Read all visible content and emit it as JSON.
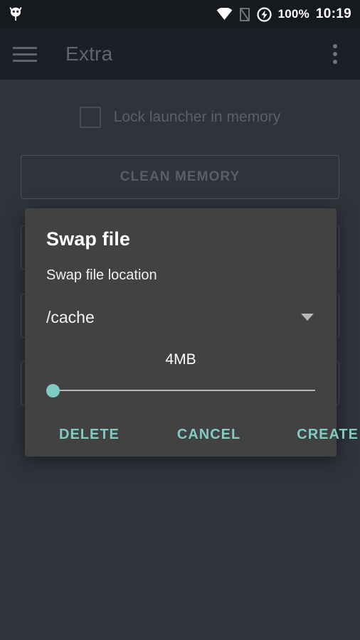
{
  "status_bar": {
    "notification_icon": "app-notification-icon",
    "wifi_icon": "wifi-icon",
    "signal_off_icon": "signal-disabled-icon",
    "charging_icon": "battery-charging-icon",
    "battery_percent": "100%",
    "clock": "10:19"
  },
  "toolbar": {
    "menu_icon": "hamburger-menu-icon",
    "title": "Extra",
    "overflow_icon": "overflow-menu-icon"
  },
  "background": {
    "lock_launcher_label": "Lock launcher in memory",
    "clean_memory_label": "CLEAN MEMORY",
    "hidden_buttons": [
      "",
      "",
      ""
    ]
  },
  "dialog": {
    "title": "Swap file",
    "subtitle": "Swap file location",
    "location_value": "/cache",
    "location_options": [
      "/cache"
    ],
    "size_label": "4MB",
    "slider": {
      "value": 4,
      "min": 4,
      "max": 2048,
      "percent": 0
    },
    "buttons": {
      "delete": "DELETE",
      "cancel": "CANCEL",
      "create": "CREATE"
    }
  },
  "colors": {
    "accent": "#80cbc4",
    "dialog_bg": "#424242",
    "page_bg": "#2f333b",
    "toolbar_bg": "#1c2026",
    "status_bg": "#16191d"
  }
}
